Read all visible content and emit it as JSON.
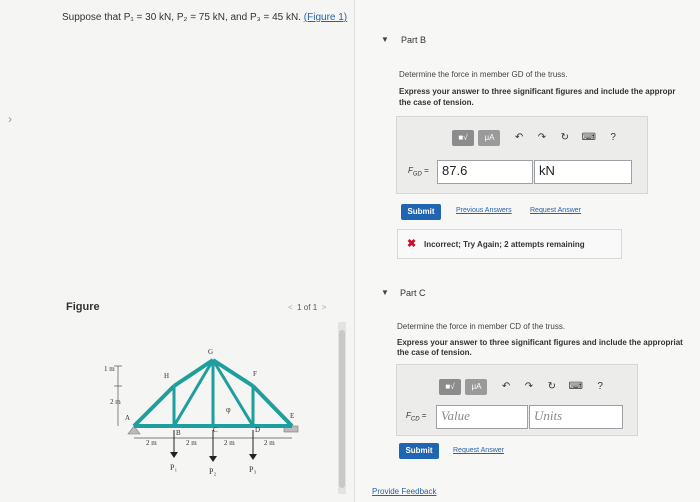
{
  "problem": {
    "prefix": "Suppose that ",
    "p1": "P₁ = 30 kN",
    "p2": "P₂ = 75 kN",
    "p3": "P₃ = 45 kN",
    "and_text": "and",
    "figure_link": "(Figure 1)"
  },
  "figure": {
    "title": "Figure",
    "pager": "1 of 1",
    "labels": {
      "dim_1m": "1 m",
      "dim_2m_left": "2 m",
      "node_a": "A",
      "node_b": "B",
      "node_c": "C",
      "node_d": "D",
      "node_e": "E",
      "node_f": "F",
      "node_g": "G",
      "node_h": "H",
      "phi": "φ",
      "span1": "2 m",
      "span2": "2 m",
      "span3": "2 m",
      "span4": "2 m",
      "load1": "P₁",
      "load2": "P₂",
      "load3": "P₃"
    }
  },
  "partB": {
    "title": "Part B",
    "question": "Determine the force in member GD of the truss.",
    "instruction_line1": "Express your answer to three significant figures and include the appropr",
    "instruction_line2": "the case of tension.",
    "var_label": "F",
    "var_sub": "GD",
    "equals": "=",
    "value": "87.6",
    "units": "kN",
    "submit": "Submit",
    "link_prev": "Previous Answers",
    "link_request": "Request Answer",
    "feedback": "Incorrect; Try Again; 2 attempts remaining",
    "toolbar": {
      "templates": "■√",
      "mu": "μA",
      "undo": "↶",
      "redo": "↷",
      "reset": "↻",
      "keyboard": "⌨",
      "help": "?"
    }
  },
  "partC": {
    "title": "Part C",
    "question": "Determine the force in member CD of the truss.",
    "instruction_line1": "Express your answer to three significant figures and include the appropriat",
    "instruction_line2": "the case of tension.",
    "var_label": "F",
    "var_sub": "CD",
    "equals": "=",
    "value_placeholder": "Value",
    "units_placeholder": "Units",
    "submit": "Submit",
    "link_request": "Request Answer",
    "toolbar": {
      "templates": "■√",
      "mu": "μA",
      "undo": "↶",
      "redo": "↷",
      "reset": "↻",
      "keyboard": "⌨",
      "help": "?"
    }
  },
  "footer": {
    "feedback_link": "Provide Feedback"
  },
  "colors": {
    "accent": "#1f65b1",
    "error": "#c8102e",
    "truss": "#1f9e9e"
  }
}
